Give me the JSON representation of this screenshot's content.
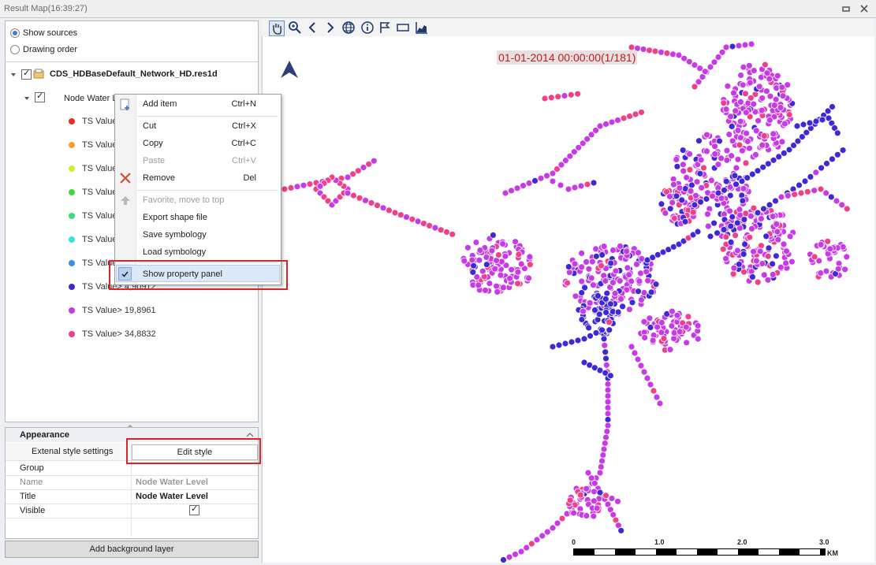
{
  "window": {
    "title": "Result Map(16:39:27)"
  },
  "sources_panel": {
    "radio_show_sources": "Show sources",
    "radio_drawing_order": "Drawing order",
    "file_name": "CDS_HDBaseDefault_Network_HD.res1d",
    "layer_name": "Node Water L",
    "legend": [
      {
        "label": "TS Value>",
        "color": "#f02828"
      },
      {
        "label": "TS Value>",
        "color": "#f7a030"
      },
      {
        "label": "TS Value>",
        "color": "#d4ec2e"
      },
      {
        "label": "TS Value>",
        "color": "#3cdb3c"
      },
      {
        "label": "TS Value>",
        "color": "#38e07a"
      },
      {
        "label": "TS Value>",
        "color": "#33e2e2"
      },
      {
        "label": "TS Value>",
        "color": "#3b8fe8"
      },
      {
        "label": "TS Value> 4,90912",
        "color": "#3f28d8"
      },
      {
        "label": "TS Value> 19,8961",
        "color": "#c83ae8"
      },
      {
        "label": "TS Value> 34,8832",
        "color": "#f0408a"
      }
    ]
  },
  "context_menu": {
    "items": [
      {
        "label": "Add item",
        "shortcut": "Ctrl+N"
      },
      {
        "label": "Cut",
        "shortcut": "Ctrl+X"
      },
      {
        "label": "Copy",
        "shortcut": "Ctrl+C"
      },
      {
        "label": "Paste",
        "shortcut": "Ctrl+V"
      },
      {
        "label": "Remove",
        "shortcut": "Del"
      },
      {
        "label": "Favorite, move to top",
        "shortcut": ""
      },
      {
        "label": "Export shape file",
        "shortcut": ""
      },
      {
        "label": "Save symbology",
        "shortcut": ""
      },
      {
        "label": "Load symbology",
        "shortcut": ""
      },
      {
        "label": "Show property panel",
        "shortcut": ""
      }
    ]
  },
  "properties": {
    "section": "Appearance",
    "external_style_label": "Extenal style settings",
    "edit_style_label": "Edit style",
    "rows": [
      {
        "key": "Group",
        "value": ""
      },
      {
        "key": "Name",
        "value": "Node Water Level"
      },
      {
        "key": "Title",
        "value": "Node Water Level"
      },
      {
        "key": "Visible",
        "value": ""
      }
    ],
    "visible_checked": true
  },
  "add_background_label": "Add background layer",
  "toolbar": {
    "icons": [
      "pan-hand-icon",
      "zoom-icon",
      "back-arrow-icon",
      "forward-arrow-icon",
      "globe-icon",
      "info-icon",
      "flag-icon",
      "rectangle-icon",
      "chart-icon"
    ]
  },
  "map": {
    "timestamp": "01-01-2014 00:00:00(1/181)",
    "scale_labels": [
      "0",
      "1.0",
      "2.0",
      "3.0"
    ],
    "scale_unit": "KM",
    "north_arrow_color": "#2b3f7a",
    "node_colors": {
      "low": "#3f28d8",
      "mid": "#c83ae8",
      "high": "#f0408a"
    }
  }
}
